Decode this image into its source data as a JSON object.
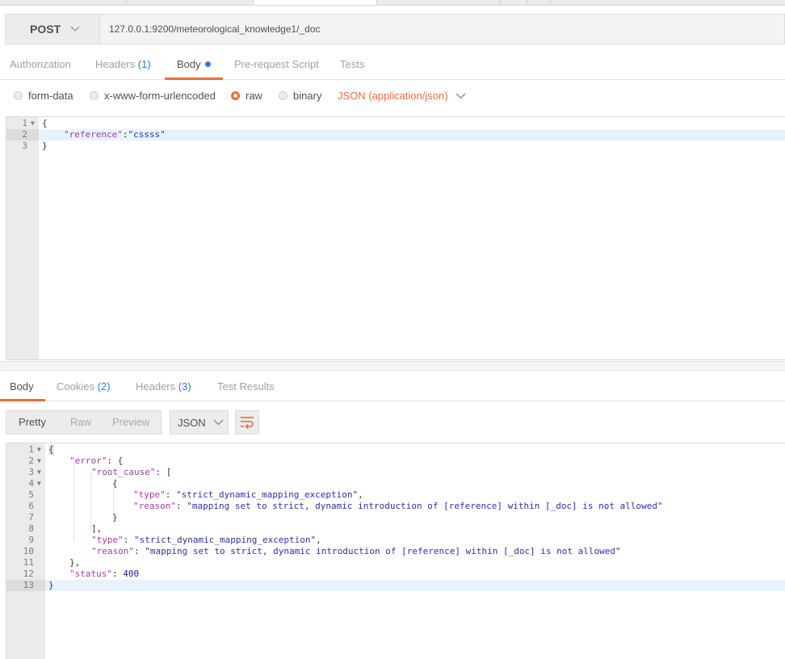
{
  "request": {
    "method": "POST",
    "url": "127.0.0.1:9200/meteorological_knowledge1/_doc"
  },
  "request_tabs": [
    {
      "label": "Authorization",
      "count": ""
    },
    {
      "label": "Headers",
      "count": "(1)"
    },
    {
      "label": "Body",
      "count": ""
    },
    {
      "label": "Pre-request Script",
      "count": ""
    },
    {
      "label": "Tests",
      "count": ""
    }
  ],
  "body_types": [
    "form-data",
    "x-www-form-urlencoded",
    "raw",
    "binary"
  ],
  "selected_body_type": "raw",
  "content_type": "JSON (application/json)",
  "request_body": {
    "line_numbers": [
      "1",
      "2",
      "3"
    ],
    "l1": "{",
    "l2_key": "\"reference\"",
    "l2_sep": ":",
    "l2_val": "\"cssss\"",
    "l3": "}"
  },
  "response_tabs": [
    {
      "label": "Body",
      "count": ""
    },
    {
      "label": "Cookies",
      "count": "(2)"
    },
    {
      "label": "Headers",
      "count": "(3)"
    },
    {
      "label": "Test Results",
      "count": ""
    }
  ],
  "view_modes": [
    "Pretty",
    "Raw",
    "Preview"
  ],
  "format": "JSON",
  "response_body": {
    "line_numbers": [
      "1",
      "2",
      "3",
      "4",
      "5",
      "6",
      "7",
      "8",
      "9",
      "10",
      "11",
      "12",
      "13"
    ],
    "k_error": "\"error\"",
    "k_root_cause": "\"root_cause\"",
    "k_type": "\"type\"",
    "k_reason": "\"reason\"",
    "k_status": "\"status\"",
    "v_type": "\"strict_dynamic_mapping_exception\"",
    "v_reason": "\"mapping set to strict, dynamic introduction of [reference] within [_doc] is not allowed\"",
    "v_status": "400"
  }
}
